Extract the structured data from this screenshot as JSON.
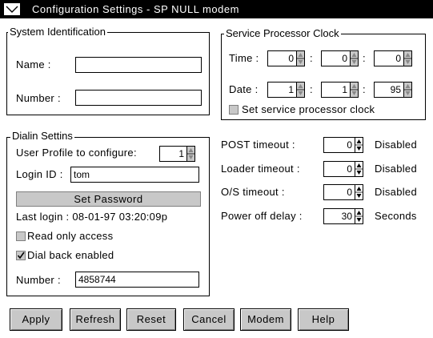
{
  "window": {
    "title": "Configuration Settings - SP NULL modem"
  },
  "system_identification": {
    "legend": "System Identification",
    "name_label": "Name :",
    "name_value": "",
    "number_label": "Number :",
    "number_value": ""
  },
  "sp_clock": {
    "legend": "Service Processor Clock",
    "time_label": "Time :",
    "time_values": [
      "0",
      "0",
      "0"
    ],
    "date_label": "Date :",
    "date_values": [
      "1",
      "1",
      "95"
    ],
    "separator": ":",
    "set_clock_label": "Set service processor clock",
    "set_clock_checked": false
  },
  "dialin": {
    "legend": "Dialin Settins",
    "profile_label": "User Profile to configure:",
    "profile_value": "1",
    "login_label": "Login ID :",
    "login_value": "tom",
    "set_password_label": "Set Password",
    "last_login_text": "Last login : 08-01-97  03:20:09p",
    "read_only_label": "Read only access",
    "read_only_checked": false,
    "dial_back_label": "Dial back enabled",
    "dial_back_checked": true,
    "number_label": "Number :",
    "number_value": "4858744"
  },
  "timeouts": [
    {
      "label": "POST timeout :",
      "value": "0",
      "unit": "Disabled"
    },
    {
      "label": "Loader timeout :",
      "value": "0",
      "unit": "Disabled"
    },
    {
      "label": "O/S timeout :",
      "value": "0",
      "unit": "Disabled"
    },
    {
      "label": "Power off delay :",
      "value": "30",
      "unit": "Seconds"
    }
  ],
  "buttons": {
    "apply": "Apply",
    "refresh": "Refresh",
    "reset": "Reset",
    "cancel": "Cancel",
    "modem": "Modem",
    "help": "Help"
  },
  "icons": {
    "system_menu": "system-menu-icon",
    "spinner": "spin-arrows-icon",
    "checkmark": "checkmark-icon"
  },
  "colors": {
    "title_bar": "#000000",
    "control_face": "#c8c8c8",
    "background": "#ffffff"
  }
}
